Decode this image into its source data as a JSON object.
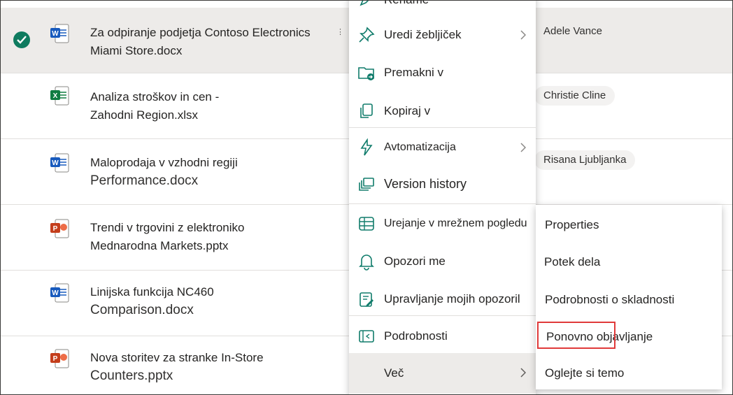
{
  "files": [
    {
      "line1": "Za odpiranje podjetja Contoso Electronics",
      "line2": "Miami Store.docx",
      "type": "word",
      "selected": true,
      "person": "Adele Vance"
    },
    {
      "line1": "Analiza stroškov in cen -",
      "line2": "Zahodni Region.xlsx",
      "type": "excel",
      "selected": false,
      "person": "Christie Cline"
    },
    {
      "line1": "Maloprodaja v vzhodni regiji",
      "line2": "Performance.docx",
      "type": "word",
      "selected": false,
      "person": "Risana Ljubljanka"
    },
    {
      "line1": "Trendi v trgovini z elektroniko",
      "line2": "Mednarodna Markets.pptx",
      "type": "powerpoint",
      "selected": false,
      "person": ""
    },
    {
      "line1": "Linijska funkcija NC460",
      "line2": "Comparison.docx",
      "type": "word",
      "selected": false,
      "person": ""
    },
    {
      "line1": "Nova storitev za stranke In-Store",
      "line2": "Counters.pptx",
      "type": "powerpoint",
      "selected": false,
      "person": ""
    }
  ],
  "menu": {
    "rename": "Rename",
    "edit_pin": "Uredi žebljiček",
    "move_to": "Premakni v",
    "copy_to": "Kopiraj v",
    "automate": "Avtomatizacija",
    "version_history": "Version history",
    "grid_edit": "Urejanje v mrežnem pogledu",
    "alert_me": "Opozori me",
    "manage_alerts": "Upravljanje mojih opozoril",
    "details": "Podrobnosti",
    "more": "Več"
  },
  "submenu": {
    "properties": "Properties",
    "workflow": "Potek dela",
    "compliance": "Podrobnosti o skladnosti",
    "republish": "Ponovno objavljanje",
    "view_topic": "Oglejte si temo"
  },
  "colors": {
    "selected_row": "#edebe9",
    "check": "#0f7b5f",
    "accent": "#107c6b",
    "highlight": "#e03a3a",
    "word": "#185abd",
    "excel": "#107c41",
    "powerpoint": "#c43e1c"
  }
}
